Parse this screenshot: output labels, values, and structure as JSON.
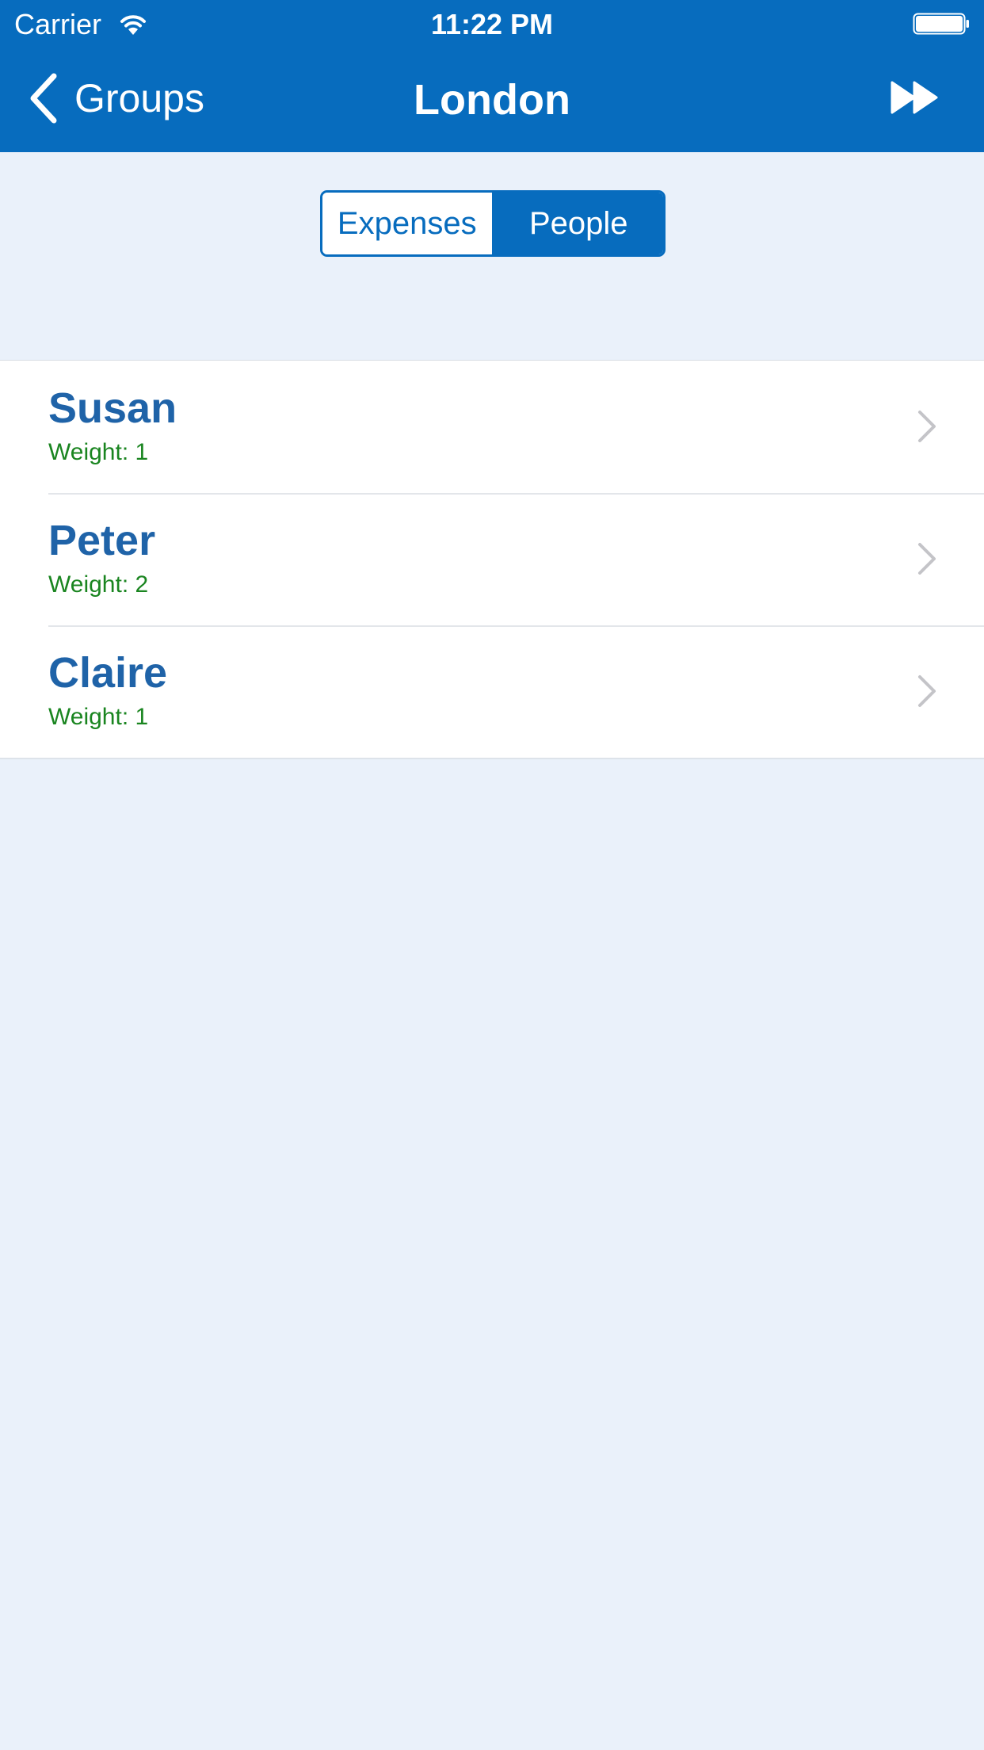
{
  "status_bar": {
    "carrier": "Carrier",
    "time": "11:22 PM"
  },
  "nav": {
    "back_label": "Groups",
    "title": "London"
  },
  "segmented_control": {
    "segments": [
      "Expenses",
      "People"
    ],
    "selected": "People"
  },
  "people": [
    {
      "name": "Susan",
      "weight": "Weight: 1"
    },
    {
      "name": "Peter",
      "weight": "Weight: 2"
    },
    {
      "name": "Claire",
      "weight": "Weight: 1"
    }
  ],
  "icons": {
    "back": "chevron-left-icon",
    "action": "fast-forward-icon",
    "row": "chevron-right-icon",
    "wifi": "wifi-icon",
    "battery": "battery-icon"
  },
  "colors": {
    "brand": "#076cbe",
    "background": "#eaf1fa",
    "name_text": "#1f63a8",
    "weight_text": "#1a8520",
    "chevron": "#c4c4c8"
  }
}
